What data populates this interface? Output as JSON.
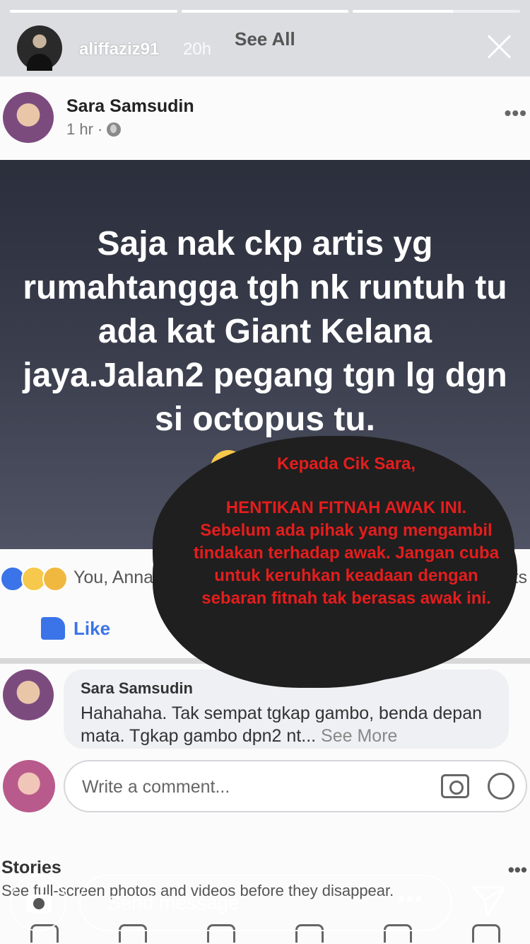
{
  "story": {
    "username": "aliffaziz91",
    "time": "20h",
    "see_all": "See All",
    "progress": [
      1.0,
      1.0,
      0.6
    ],
    "send_placeholder": "Send message",
    "more_dots": "•••"
  },
  "post": {
    "author": "Sara Samsudin",
    "time": "1 hr ·",
    "more": "•••",
    "image_text": "Saja nak ckp artis yg rumahtangga tgh nk runtuh tu ada kat Giant Kelana jaya.Jalan2 pegang tgn lg dgn si octopus tu.",
    "reactions_text": "You, Anna",
    "comments_count": "nts",
    "like_label": "Like"
  },
  "comment": {
    "author": "Sara Samsudin",
    "text": "Hahahaha. Tak sempat tgkap gambo, benda depan mata. Tgkap gambo dpn2 nt...",
    "see_more": "See More",
    "write_placeholder": "Write a comment..."
  },
  "stories": {
    "title": "Stories",
    "more": "•••",
    "description": "See full-screen photos and videos before they disappear."
  },
  "overlay": {
    "line1": "Kepada Cik Sara,",
    "line2": "HENTIKAN FITNAH AWAK INI. Sebelum ada pihak yang mengambil tindakan terhadap awak. Jangan cuba untuk keruhkan keadaan dengan sebaran fitnah tak berasas awak ini."
  },
  "colors": {
    "overlay_text": "#e51d1d",
    "facebook_blue": "#3b74e8"
  }
}
